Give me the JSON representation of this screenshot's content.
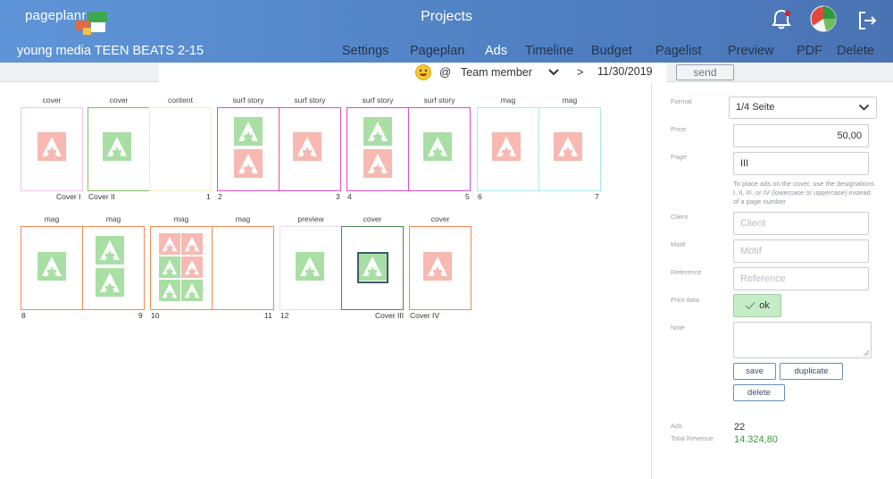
{
  "header": {
    "logo_text": "pageplanr",
    "title": "Projects",
    "project_name": "young media TEEN BEATS 2-15",
    "icons": [
      "bell-icon",
      "pie-chart-icon",
      "logout-icon"
    ]
  },
  "nav": {
    "items": [
      "Settings",
      "Pageplan",
      "Ads",
      "Timeline",
      "Budget",
      "Pagelist",
      "Preview",
      "PDF",
      "Delete"
    ],
    "active": "Ads"
  },
  "subbar": {
    "at": "@",
    "member": "Team member",
    "gt": ">",
    "date": "11/30/2019",
    "send": "send"
  },
  "spreads": [
    {
      "row": 1,
      "pages": [
        {
          "type": "cover",
          "num": "Cover I",
          "color": "#f0c4e3"
        },
        {
          "type": "cover",
          "num": "Cover II",
          "color": "#86b866"
        },
        {
          "type": "content",
          "num": "1",
          "color": "#f2f2b6"
        },
        {
          "type": "surf story",
          "num": "2",
          "color": "#d64fc2"
        },
        {
          "type": "surf story",
          "num": "3",
          "color": "#d64fc2"
        },
        {
          "type": "surf story",
          "num": "4",
          "color": "#d64fc2"
        },
        {
          "type": "surf story",
          "num": "5",
          "color": "#d64fc2"
        },
        {
          "type": "mag",
          "num": "6",
          "color": "#a9ebe3"
        },
        {
          "type": "mag",
          "num": "7",
          "color": "#a9ebe3"
        }
      ]
    },
    {
      "row": 2,
      "pages": [
        {
          "type": "mag",
          "num": "8",
          "color": "#ef8a52"
        },
        {
          "type": "mag",
          "num": "9",
          "color": "#ef8a52"
        },
        {
          "type": "mag",
          "num": "10",
          "color": "#ef8a52"
        },
        {
          "type": "mag",
          "num": "11",
          "color": "#ef8a52"
        },
        {
          "type": "preview",
          "num": "12",
          "color": "#f3d8ee"
        },
        {
          "type": "cover",
          "num": "Cover III",
          "color": "#4a8a4a"
        },
        {
          "type": "cover",
          "num": "Cover IV",
          "color": "#ef8a52"
        }
      ]
    }
  ],
  "ad_colors": {
    "pink": "#f7b9b2",
    "green": "#a9dfa5",
    "frame": "#3d5a6e"
  },
  "form": {
    "format_label": "Format",
    "format_value": "1/4 Seite",
    "price_label": "Price",
    "price_value": "50,00",
    "page_label": "Page",
    "page_value": "III",
    "hint": "To place ads on the cover, use the designations I, II, III, or IV (lowercase or uppercase) instead of a page number",
    "client_label": "Client",
    "client_placeholder": "Client",
    "motif_label": "Motif",
    "motif_placeholder": "Motif",
    "reference_label": "Reference",
    "reference_placeholder": "Reference",
    "print_label": "Print data",
    "print_ok": "ok",
    "note_label": "Note",
    "save": "save",
    "duplicate": "duplicate",
    "delete": "delete"
  },
  "stats": {
    "ads_label": "Ads",
    "ads_value": "22",
    "revenue_label": "Total Revenue",
    "revenue_value": "14.324,80"
  }
}
